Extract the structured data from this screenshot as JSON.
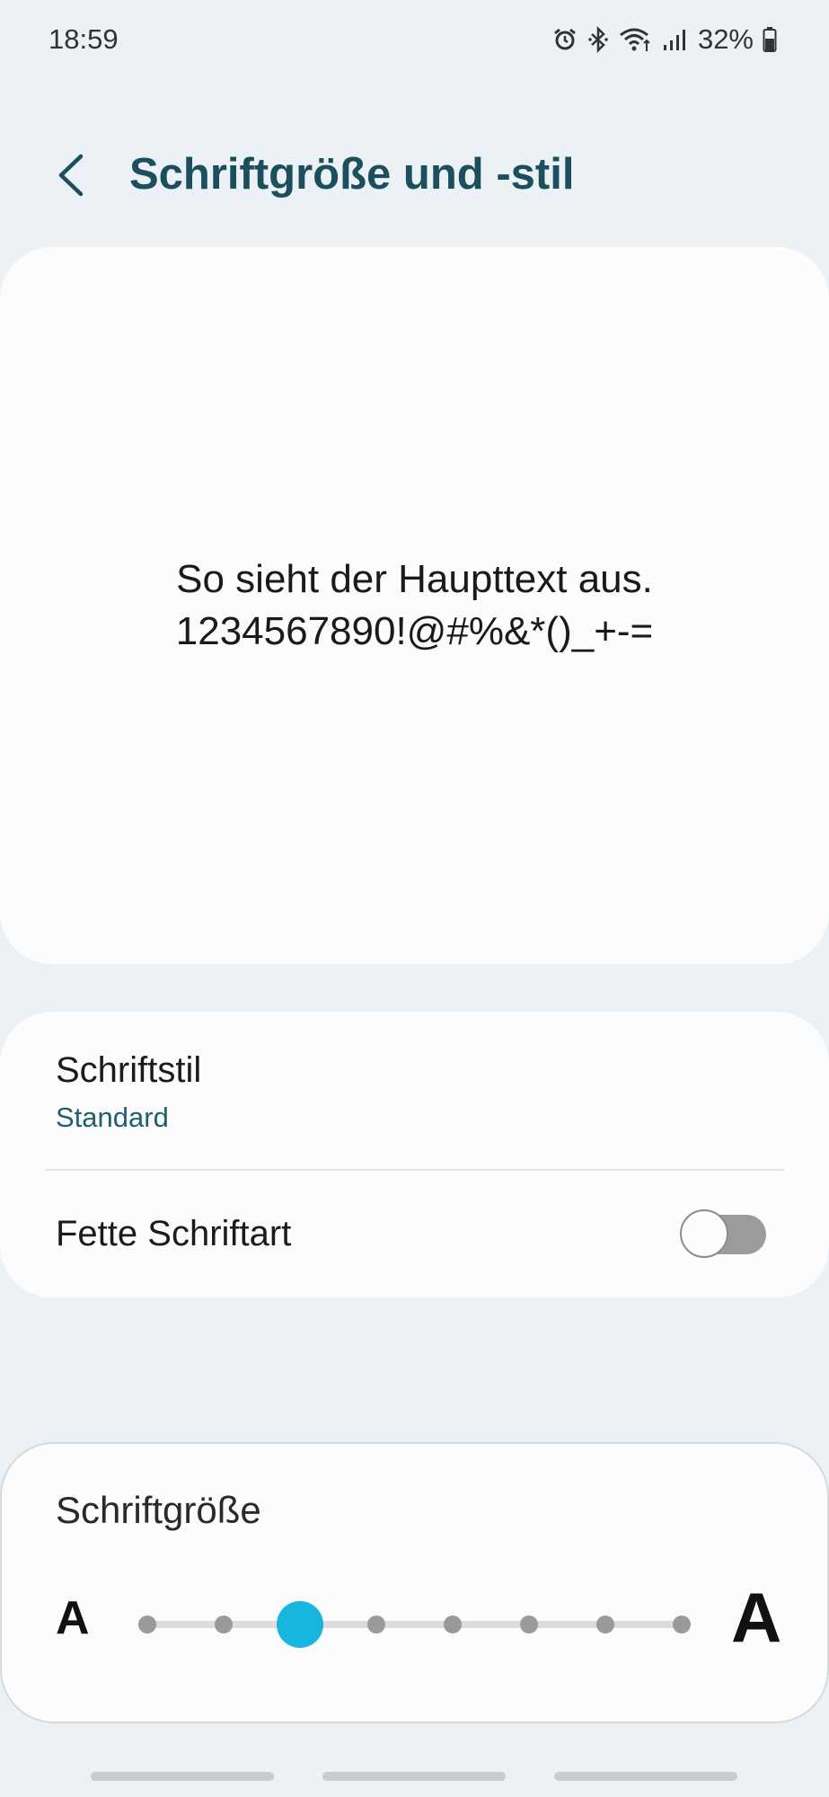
{
  "status_bar": {
    "time": "18:59",
    "battery": "32%",
    "icons": [
      "alarm-icon",
      "bluetooth-icon",
      "wifi-icon",
      "signal-icon",
      "battery-icon"
    ]
  },
  "header": {
    "back_icon": "chevron-left-icon",
    "title": "Schriftgröße und -stil"
  },
  "preview": {
    "line1": "So sieht der Haupttext aus.",
    "line2": "1234567890!@#%&*()_+-="
  },
  "settings": {
    "font_style": {
      "title": "Schriftstil",
      "value": "Standard"
    },
    "bold_font": {
      "label": "Fette Schriftart",
      "enabled": false
    }
  },
  "font_size": {
    "title": "Schriftgröße",
    "small_label": "A",
    "large_label": "A",
    "steps": 8,
    "selected_index": 2
  },
  "colors": {
    "accent": "#18b5de",
    "title": "#1c4f5d",
    "subtitle": "#1f5f70",
    "background": "#ebf1f4",
    "card": "#fcfcfc"
  }
}
